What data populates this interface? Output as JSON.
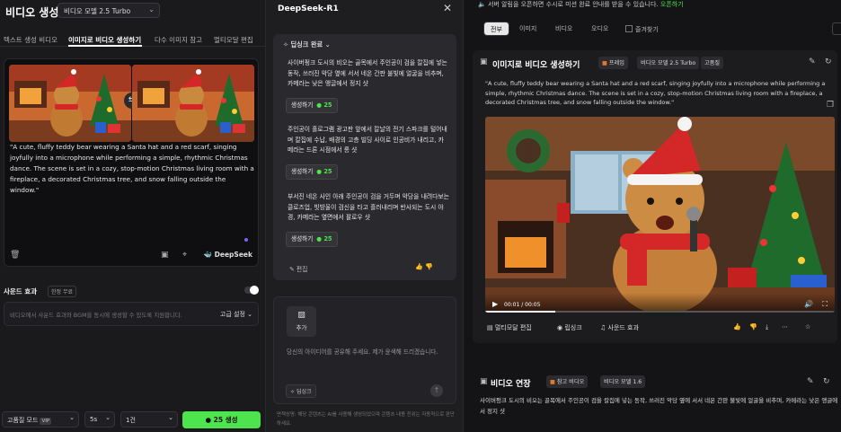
{
  "left": {
    "title": "비디오 생성",
    "model": "비디오 모델 2.5 Turbo",
    "tabs": [
      "텍스트 생성 비디오",
      "이미지로 비디오 생성하기",
      "다수 이미지 참고",
      "멀티모달 편집"
    ],
    "active_tab": 1,
    "prompt": "\"A cute, fluffy teddy bear wearing a Santa hat and a red scarf, singing joyfully into a microphone while performing a simple, rhythmic Christmas dance. The scene is set in a cozy, stop-motion Christmas living room with a fireplace, a decorated Christmas tree, and snow falling outside the window.\"",
    "brand": "DeepSeek",
    "sound_label": "사운드 효과",
    "sound_badge": "한정 무료",
    "sound_placeholder": "비디오에서 사운드 효과와 BGM을 동시에 생성할 수 있도록 지원합니다.",
    "advanced": "고급 설정",
    "mode": "고품질 모드",
    "vip": "VIP",
    "duration": "5s",
    "count": "1건",
    "generate_cost": "25",
    "generate_label": "생성"
  },
  "mid": {
    "title": "DeepSeek-R1",
    "synced": "딥싱크 완료",
    "items": [
      {
        "text": "사이버펑크 도시의 비오는 골목에서 주인공이 검을 칼집에 넣는 동작, 쓰러진 악당 옆에 서서 네온 간판 불빛에 얼굴을 비추며, 카메라는 낮은 앵글에서 정지 샷",
        "btn": "생성하기",
        "cost": "25"
      },
      {
        "text": "주인공이 홀로그램 광고판 앞에서 칼날의 전기 스파크를 털어내며 칼집에 수납, 배경의 고층 빌딩 사이로 인공비가 내리고, 카메라는 드론 시점에서 롱 샷",
        "btn": "생성하기",
        "cost": "25"
      },
      {
        "text": "부서진 네온 사인 아래 주인공이 검을 거두며 악당을 내려다보는 클로즈업, 빗방울이 검신을 타고 흘러내리며 반사되는 도시 야경, 카메라는 옆면에서 팔로우 샷",
        "btn": "생성하기",
        "cost": "25"
      }
    ],
    "edit": "편집",
    "add": "추가",
    "share_placeholder": "당신의 아이디어를 공유해 주세요. 제가 윤색해 드리겠습니다.",
    "sync_chip": "딥싱크",
    "disclaimer": "면책성명: 해당 콘텐츠는 AI를 사용해 생성되었으며 콘텐츠 내용 진위는 자동적으로 판단하세요."
  },
  "right": {
    "notice": "서버 알림을 오픈하면 수시로 미션 완료 안내를 받을 수 있습니다.",
    "notice_link": "오픈하기",
    "filters": [
      "전부",
      "이미지",
      "비디오",
      "오디오"
    ],
    "active_filter": 0,
    "favorites": "즐겨찾기",
    "card1": {
      "title": "이미지로 비디오 생성하기",
      "chip_frame": "프레임",
      "chip_model": "비디오 모델 2.5 Turbo",
      "chip_quality": "고품질",
      "prompt": "\"A cute, fluffy teddy bear wearing a Santa hat and a red scarf, singing joyfully into a microphone while performing a simple, rhythmic Christmas dance. The scene is set in a cozy, stop-motion Christmas living room with a fireplace, a decorated Christmas tree, and snow falling outside the window.\"",
      "time": "00:01 / 00:05",
      "progress": 0.2,
      "actions": [
        "멀티모달 편집",
        "립싱크",
        "사운드 효과"
      ]
    },
    "card2": {
      "title": "비디오 연장",
      "chip_ref": "참고 비디오",
      "chip_model": "비디오 모델 1.6",
      "text": "사이버펑크 도시의 비오는 골목에서 주인공이 검을 칼집에 넣는 동작, 쓰러진 악당 옆에 서서 네온 간판 불빛에 얼굴을 비추며, 카메라는 낮은 앵글에서 정지 샷"
    }
  }
}
